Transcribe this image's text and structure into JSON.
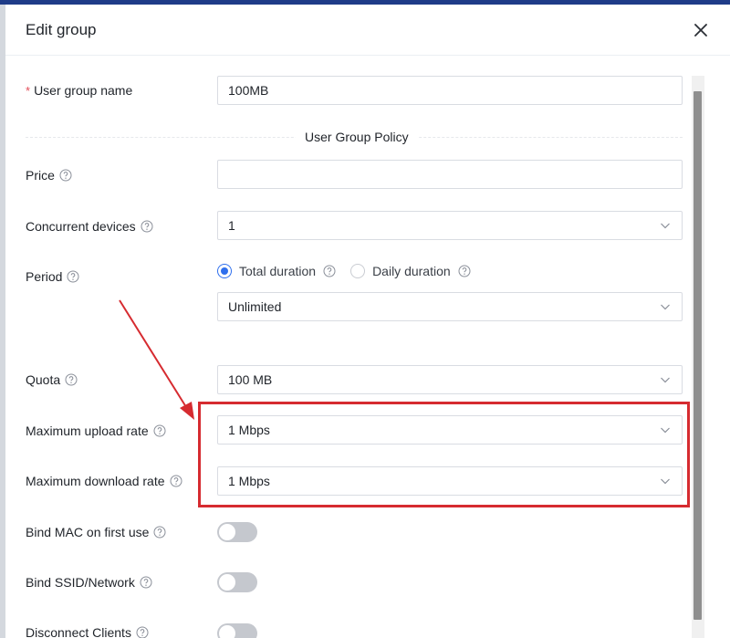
{
  "dialog": {
    "title": "Edit group"
  },
  "form": {
    "group_name_label": "User group name",
    "group_name_value": "100MB",
    "section_title": "User Group Policy",
    "price_label": "Price",
    "price_value": "",
    "concurrent_label": "Concurrent devices",
    "concurrent_value": "1",
    "period_label": "Period",
    "period_options": [
      "Total duration",
      "Daily duration"
    ],
    "period_selected": "Total duration",
    "period_value": "Unlimited",
    "quota_label": "Quota",
    "quota_value": "100 MB",
    "upload_label": "Maximum upload rate",
    "upload_value": "1 Mbps",
    "download_label": "Maximum download rate",
    "download_value": "1 Mbps",
    "bind_mac_label": "Bind MAC on first use",
    "bind_mac_on": false,
    "bind_ssid_label": "Bind SSID/Network",
    "bind_ssid_on": false,
    "disconnect_label": "Disconnect Clients",
    "disconnect_on": false
  },
  "icons": {
    "close": "close-icon",
    "help": "help-circle-icon",
    "dropdown": "chevron-down-icon"
  },
  "colors": {
    "primary": "#2f6fed",
    "required": "#e34d59",
    "annotation": "#d62b30",
    "toggle_off": "#c5c8ce"
  }
}
